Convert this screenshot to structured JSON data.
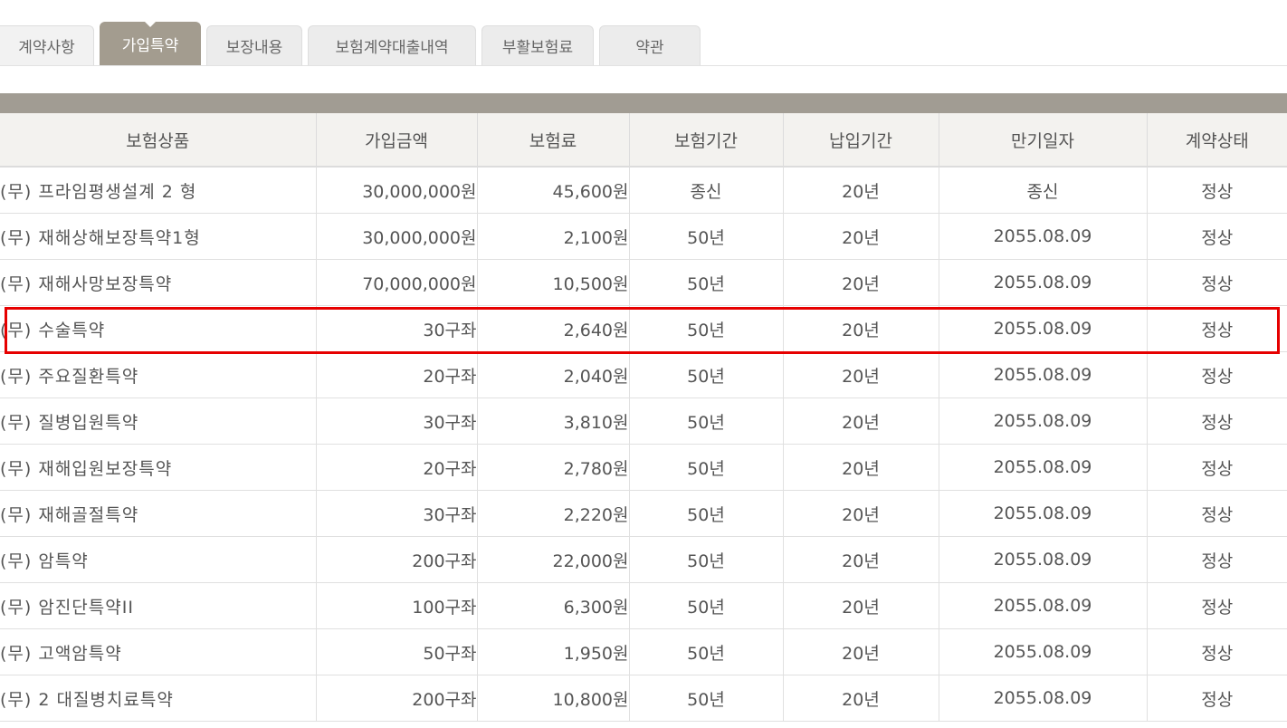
{
  "tabs": [
    {
      "label": "계약사항",
      "active": false
    },
    {
      "label": "가입특약",
      "active": true
    },
    {
      "label": "보장내용",
      "active": false
    },
    {
      "label": "보험계약대출내역",
      "active": false
    },
    {
      "label": "부활보험료",
      "active": false
    },
    {
      "label": "약관",
      "active": false
    }
  ],
  "table": {
    "headers": [
      "보험상품",
      "가입금액",
      "보험료",
      "보험기간",
      "납입기간",
      "만기일자",
      "계약상태"
    ],
    "rows": [
      [
        "(무) 프라임평생설계 2 형",
        "30,000,000원",
        "45,600원",
        "종신",
        "20년",
        "종신",
        "정상"
      ],
      [
        "(무) 재해상해보장특약1형",
        "30,000,000원",
        "2,100원",
        "50년",
        "20년",
        "2055.08.09",
        "정상"
      ],
      [
        "(무) 재해사망보장특약",
        "70,000,000원",
        "10,500원",
        "50년",
        "20년",
        "2055.08.09",
        "정상"
      ],
      [
        "(무) 수술특약",
        "30구좌",
        "2,640원",
        "50년",
        "20년",
        "2055.08.09",
        "정상"
      ],
      [
        "(무) 주요질환특약",
        "20구좌",
        "2,040원",
        "50년",
        "20년",
        "2055.08.09",
        "정상"
      ],
      [
        "(무) 질병입원특약",
        "30구좌",
        "3,810원",
        "50년",
        "20년",
        "2055.08.09",
        "정상"
      ],
      [
        "(무) 재해입원보장특약",
        "20구좌",
        "2,780원",
        "50년",
        "20년",
        "2055.08.09",
        "정상"
      ],
      [
        "(무) 재해골절특약",
        "30구좌",
        "2,220원",
        "50년",
        "20년",
        "2055.08.09",
        "정상"
      ],
      [
        "(무) 암특약",
        "200구좌",
        "22,000원",
        "50년",
        "20년",
        "2055.08.09",
        "정상"
      ],
      [
        "(무) 암진단특약II",
        "100구좌",
        "6,300원",
        "50년",
        "20년",
        "2055.08.09",
        "정상"
      ],
      [
        "(무) 고액암특약",
        "50구좌",
        "1,950원",
        "50년",
        "20년",
        "2055.08.09",
        "정상"
      ],
      [
        "(무) 2 대질병치료특약",
        "200구좌",
        "10,800원",
        "50년",
        "20년",
        "2055.08.09",
        "정상"
      ]
    ],
    "highlighted_row": 3
  },
  "colors": {
    "active_tab": "#a39c8f",
    "header_bar": "#a19c93",
    "highlight": "#e60000"
  }
}
